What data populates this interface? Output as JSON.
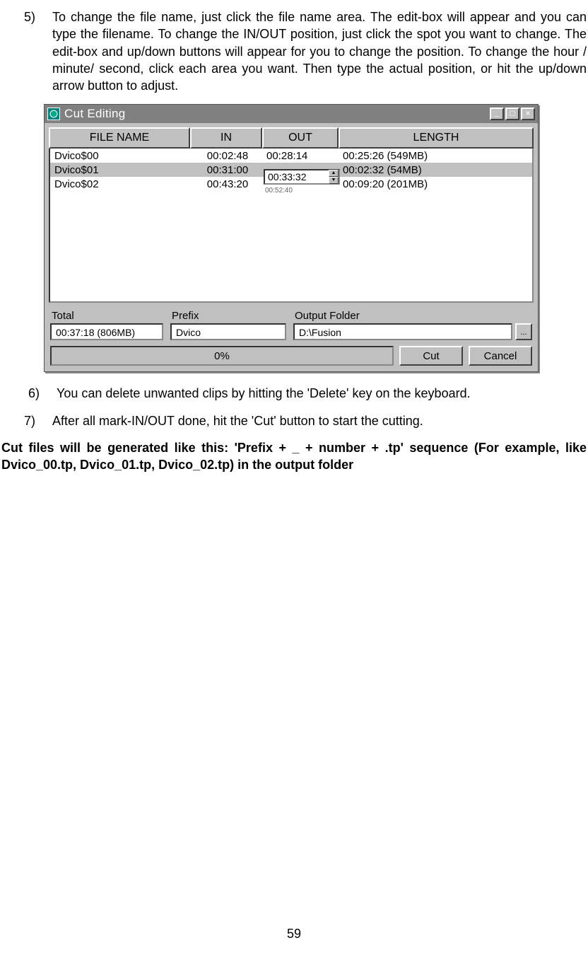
{
  "items": {
    "5": {
      "num": "5)",
      "text": "To change the file name, just click the file name area. The edit-box will appear and you can type the filename. To change the IN/OUT position, just click the spot you want to change. The edit-box and up/down buttons will appear for you to change the position. To change the hour / minute/ second, click each area you want. Then type the actual position, or hit the up/down arrow button to adjust."
    },
    "6": {
      "num": "6)",
      "text": "You can delete unwanted clips by hitting the 'Delete' key on the keyboard."
    },
    "7": {
      "num": "7)",
      "text": "After all mark-IN/OUT done, hit the 'Cut' button to start the cutting."
    }
  },
  "bold_para": "Cut files will be generated like this:   'Prefix + _ + number + .tp' sequence (For example, like Dvico_00.tp, Dvico_01.tp, Dvico_02.tp) in the output folder",
  "page_number": "59",
  "window": {
    "title": "Cut Editing",
    "headers": {
      "filename": "FILE NAME",
      "in": "IN",
      "out": "OUT",
      "length": "LENGTH"
    },
    "rows": {
      "0": {
        "filename": "Dvico$00",
        "in": "00:02:48",
        "out": "00:28:14",
        "length": "00:25:26 (549MB)"
      },
      "1": {
        "filename": "Dvico$01",
        "in": "00:31:00",
        "out": "00:33:32",
        "length": "00:02:32 (54MB)",
        "selected": true
      },
      "2": {
        "filename": "Dvico$02",
        "in": "00:43:20",
        "out_ghost": "00:52:40",
        "length": "00:09:20 (201MB)"
      }
    },
    "spin_value": "00:33:32",
    "labels": {
      "total": "Total",
      "prefix": "Prefix",
      "output": "Output Folder"
    },
    "values": {
      "total": "00:37:18 (806MB)",
      "prefix": "Dvico",
      "output": "D:\\Fusion"
    },
    "progress": "0%",
    "buttons": {
      "cut": "Cut",
      "cancel": "Cancel",
      "browse": "..."
    },
    "ctrl": {
      "min": "_",
      "max": "□",
      "close": "×"
    }
  }
}
